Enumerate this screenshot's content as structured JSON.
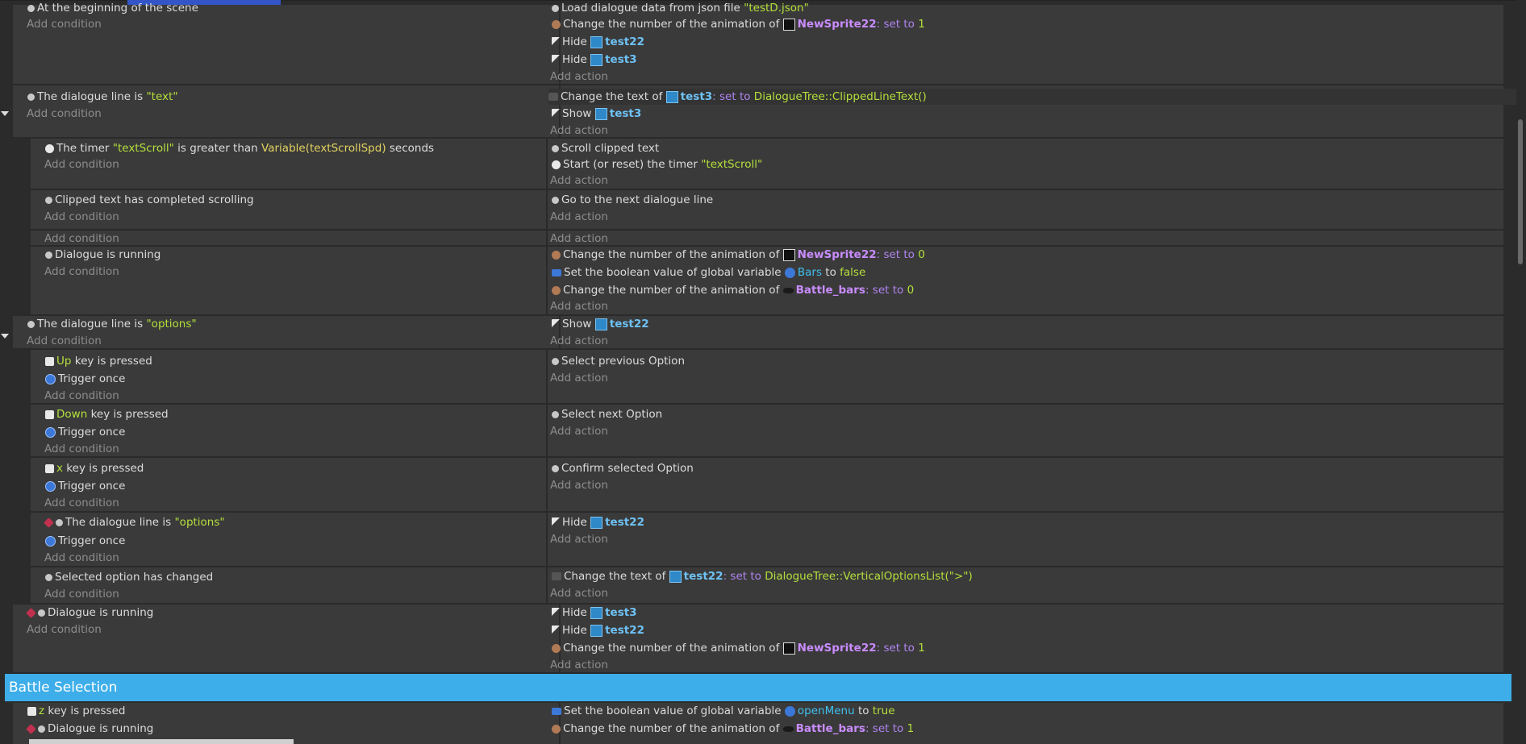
{
  "events": [
    {
      "conditions": [
        "At the beginning of the scene"
      ],
      "add_condition": "Add condition",
      "actions": [
        "Load dialogue data from json file \"testD.json\"",
        "Change the number of the animation of",
        "Hide",
        "Hide"
      ],
      "add_action": "Add action"
    }
  ],
  "labels": {
    "add_condition": "Add condition",
    "add_action": "Add action",
    "change_anim": "Change the number of the animation of",
    "set_to": "set to",
    "hide": "Hide",
    "show": "Show",
    "change_text": "Change the text of",
    "set_bool": "Set the boolean value of global variable",
    "to": "to",
    "dialogue_line_is": "The dialogue line is",
    "dialogue_running": "Dialogue is running",
    "trigger_once": "Trigger once",
    "key_is_pressed": "key is pressed"
  },
  "objects": {
    "sprite": "NewSprite22",
    "test22": "test22",
    "test3": "test3",
    "bars": "Battle_bars",
    "var_bars": "Bars",
    "var_openmenu": "openMenu"
  },
  "e1": {
    "cond": "At the beginning of the scene",
    "act0_pre": "Load dialogue data from json file",
    "act0_str": "\"testD.json\"",
    "v1": "1"
  },
  "e2": {
    "cond_str": "\"text\"",
    "act0_expr": "DialogueTree::ClippedLineText()"
  },
  "e3": {
    "cond_pre": "The timer",
    "cond_str": "\"textScroll\"",
    "cond_mid": "is greater than",
    "cond_var": "Variable(textScrollSpd)",
    "cond_post": "seconds",
    "act0": "Scroll clipped text",
    "act1_pre": "Start (or reset) the timer",
    "act1_str": "\"textScroll\""
  },
  "e4": {
    "cond": "Clipped text has completed scrolling",
    "act0": "Go to the next dialogue line"
  },
  "e6": {
    "v0": "0",
    "bool_false": "false",
    "v2": "0"
  },
  "e7": {
    "cond_str": "\"options\""
  },
  "e8": {
    "key": "Up",
    "act0": "Select previous Option"
  },
  "e9": {
    "key": "Down",
    "act0": "Select next Option"
  },
  "e10": {
    "key": "x",
    "act0": "Confirm selected Option"
  },
  "e11": {
    "cond_str": "\"options\""
  },
  "e12": {
    "cond": "Selected option has changed",
    "act0_expr": "DialogueTree::VerticalOptionsList(\">\")"
  },
  "e13": {
    "v": "1"
  },
  "section": {
    "title": "Battle Selection"
  },
  "e14": {
    "key": "z",
    "bool_true": "true",
    "v1": "1"
  }
}
